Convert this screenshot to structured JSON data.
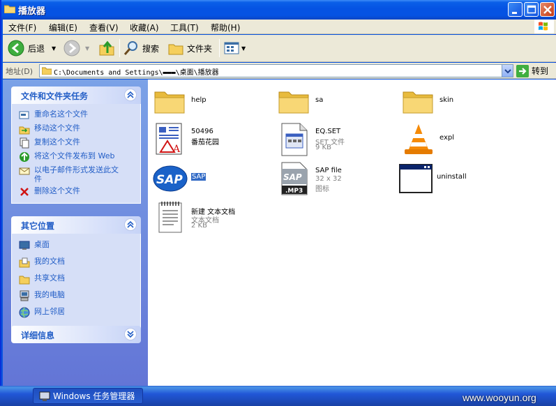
{
  "window": {
    "title": "播放器"
  },
  "menu": [
    "文件(F)",
    "编辑(E)",
    "查看(V)",
    "收藏(A)",
    "工具(T)",
    "帮助(H)"
  ],
  "toolbar": {
    "back_label": "后退",
    "search_label": "搜索",
    "folders_label": "文件夹"
  },
  "address": {
    "label": "地址(D)",
    "path": "C:\\Documents and Settings\\▬▬▬\\桌面\\播放器",
    "go_label": "转到"
  },
  "tasks_panel": {
    "title": "文件和文件夹任务",
    "items": [
      "重命名这个文件",
      "移动这个文件",
      "复制这个文件",
      "将这个文件发布到 Web",
      "以电子邮件形式发送此文件",
      "删除这个文件"
    ]
  },
  "places_panel": {
    "title": "其它位置",
    "items": [
      "桌面",
      "我的文档",
      "共享文档",
      "我的电脑",
      "网上邻居"
    ]
  },
  "details_panel": {
    "title": "详细信息"
  },
  "files": [
    {
      "name": "help",
      "icon": "folder-icon"
    },
    {
      "name": "sa",
      "icon": "folder-icon"
    },
    {
      "name": "skin",
      "icon": "folder-icon"
    },
    {
      "name": "50496",
      "line2": "番茄花园",
      "icon": "document-image-icon"
    },
    {
      "name": "EQ.SET",
      "line2": "SET 文件",
      "line3": "9 KB",
      "icon": "settings-file-icon"
    },
    {
      "name": "expl",
      "icon": "vlc-cone-icon"
    },
    {
      "name": "SAP",
      "icon": "sap-logo-icon",
      "selected": true
    },
    {
      "name": "SAP file",
      "line2": "32 x 32",
      "line3": "图标",
      "icon": "sap-mp3-icon"
    },
    {
      "name": "uninstall",
      "icon": "application-window-icon"
    },
    {
      "name": "新建 文本文档",
      "line2": "文本文档",
      "line3": "2 KB",
      "icon": "text-document-icon"
    }
  ],
  "taskbar": {
    "task_label": "Windows 任务管理器"
  },
  "watermark": "www.wooyun.org"
}
